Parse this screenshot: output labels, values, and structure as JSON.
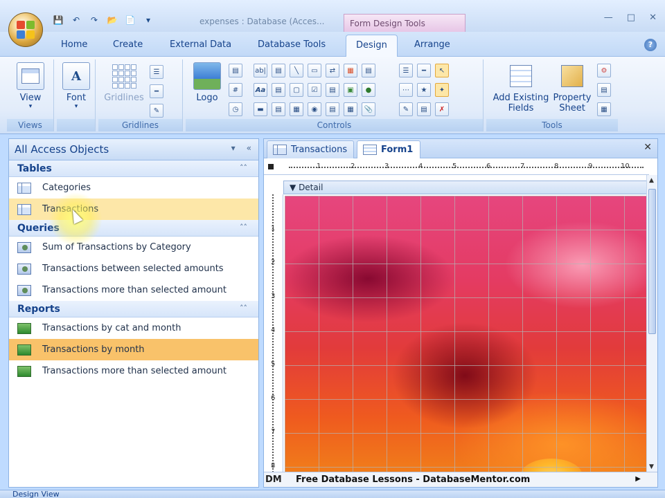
{
  "title_bar": {
    "document_title": "expenses : Database (Acces...",
    "context_tab": "Form Design Tools"
  },
  "ribbon_tabs": [
    "Home",
    "Create",
    "External Data",
    "Database Tools",
    "Design",
    "Arrange"
  ],
  "ribbon": {
    "views": {
      "view_label": "View",
      "group": "Views"
    },
    "font": {
      "font_label": "Font",
      "group": ""
    },
    "gridlines": {
      "gridlines_label": "Gridlines",
      "group": "Gridlines"
    },
    "controls": {
      "logo_label": "Logo",
      "group": "Controls",
      "glyph_abl": "ab|",
      "glyph_aa": "Aa"
    },
    "tools": {
      "add_fields_label": "Add Existing Fields",
      "property_sheet_label": "Property Sheet",
      "group": "Tools"
    }
  },
  "nav": {
    "header": "All Access Objects",
    "groups": [
      {
        "title": "Tables",
        "items": [
          "Categories",
          "Transactions"
        ]
      },
      {
        "title": "Queries",
        "items": [
          "Sum of Transactions by Category",
          "Transactions between selected amounts",
          "Transactions more than selected amount"
        ]
      },
      {
        "title": "Reports",
        "items": [
          "Transactions by cat and month",
          "Transactions by month",
          "Transactions more than selected amount"
        ]
      }
    ]
  },
  "doc_tabs": [
    "Transactions",
    "Form1"
  ],
  "form": {
    "section": "Detail",
    "ruler_top": [
      "1",
      "2",
      "3",
      "4",
      "5",
      "6",
      "7",
      "8",
      "9",
      "10"
    ],
    "ruler_left": [
      "1",
      "2",
      "3",
      "4",
      "5",
      "6",
      "7",
      "8"
    ]
  },
  "footer": {
    "dm": "DM",
    "watermark": "Free Database Lessons - DatabaseMentor.com"
  },
  "status_bar": {
    "text": "Design View"
  },
  "colors": {
    "ribbon_blue": "#bfdbff",
    "selected_item": "#f9c26a",
    "hover_item": "#fde7a8"
  }
}
